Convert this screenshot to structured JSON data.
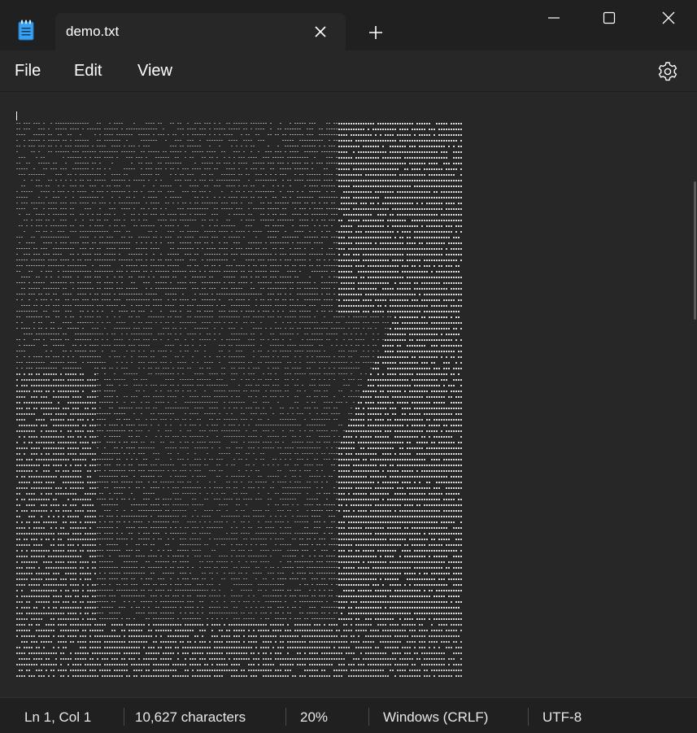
{
  "tab": {
    "title": "demo.txt"
  },
  "icons": {
    "app": "notepad-icon",
    "tab_close": "close-icon",
    "new_tab": "plus-icon",
    "minimize": "minimize-icon",
    "maximize": "maximize-icon",
    "close": "close-icon",
    "settings": "gear-icon"
  },
  "menu": {
    "file": "File",
    "edit": "Edit",
    "view": "View"
  },
  "status": {
    "position": "Ln 1, Col 1",
    "characters": "10,627 characters",
    "zoom": "20%",
    "line_ending": "Windows (CRLF)",
    "encoding": "UTF-8"
  },
  "colors": {
    "titlebar_bg": "#202020",
    "editor_bg": "#272727",
    "text": "#ffffff",
    "accent_icon": "#3aa0f3"
  }
}
